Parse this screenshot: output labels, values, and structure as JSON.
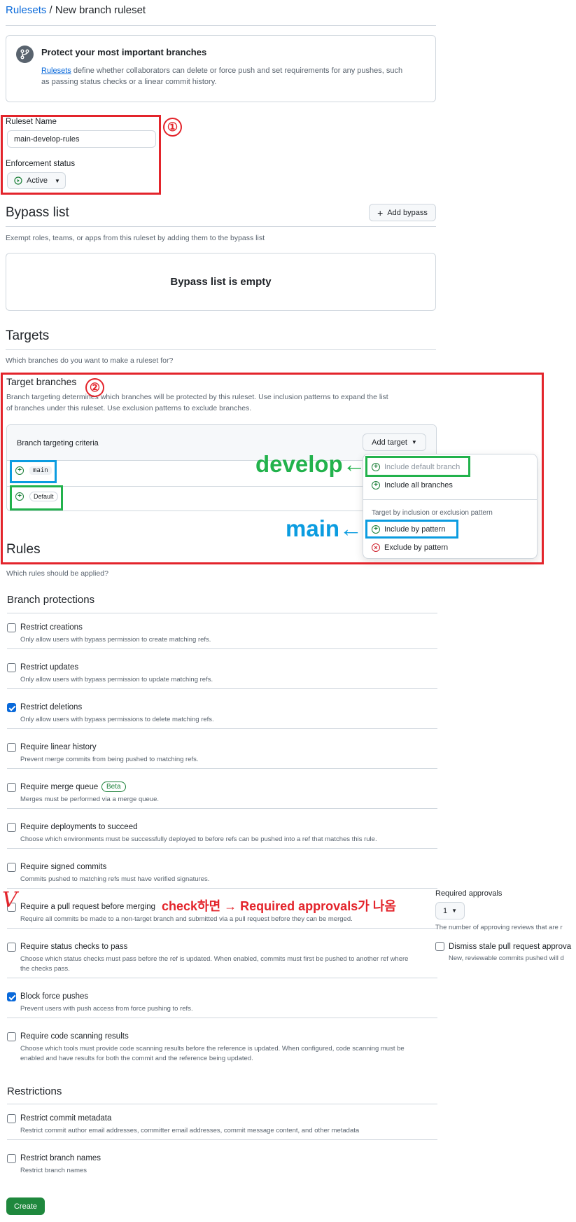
{
  "breadcrumb": {
    "root": "Rulesets",
    "sep": "/",
    "current": "New branch ruleset"
  },
  "banner": {
    "title": "Protect your most important branches",
    "link": "Rulesets",
    "text1": " define whether collaborators can delete or force push and set requirements for any pushes, such",
    "text2": "as passing status checks or a linear commit history."
  },
  "ruleset": {
    "name_label": "Ruleset Name",
    "name_value": "main-develop-rules",
    "enforcement_label": "Enforcement status",
    "enforcement_value": "Active"
  },
  "bypass": {
    "heading": "Bypass list",
    "add_button": "Add bypass",
    "description": "Exempt roles, teams, or apps from this ruleset by adding them to the bypass list",
    "empty": "Bypass list is empty"
  },
  "targets": {
    "heading": "Targets",
    "description": "Which branches do you want to make a ruleset for?",
    "branches_heading": "Target branches",
    "branches_desc1": "Branch targeting determines which branches will be protected by this ruleset. Use inclusion patterns to expand the list",
    "branches_desc2": "of branches under this ruleset. Use exclusion patterns to exclude branches.",
    "criteria_label": "Branch targeting criteria",
    "add_target": "Add target",
    "rows": [
      "main",
      "Default"
    ],
    "menu": {
      "include_default": "Include default branch",
      "include_all": "Include all branches",
      "section": "Target by inclusion or exclusion pattern",
      "include_pattern": "Include by pattern",
      "exclude_pattern": "Exclude by pattern"
    }
  },
  "rules": {
    "heading": "Rules",
    "description": "Which rules should be applied?",
    "protections_heading": "Branch protections",
    "items": [
      {
        "title": "Restrict creations",
        "desc": "Only allow users with bypass permission to create matching refs.",
        "checked": false
      },
      {
        "title": "Restrict updates",
        "desc": "Only allow users with bypass permission to update matching refs.",
        "checked": false
      },
      {
        "title": "Restrict deletions",
        "desc": "Only allow users with bypass permissions to delete matching refs.",
        "checked": true
      },
      {
        "title": "Require linear history",
        "desc": "Prevent merge commits from being pushed to matching refs.",
        "checked": false
      },
      {
        "title": "Require merge queue",
        "badge": "Beta",
        "desc": "Merges must be performed via a merge queue.",
        "checked": false
      },
      {
        "title": "Require deployments to succeed",
        "desc": "Choose which environments must be successfully deployed to before refs can be pushed into a ref that matches this rule.",
        "checked": false
      },
      {
        "title": "Require signed commits",
        "desc": "Commits pushed to matching refs must have verified signatures.",
        "checked": false
      },
      {
        "title": "Require a pull request before merging",
        "desc": "Require all commits be made to a non-target branch and submitted via a pull request before they can be merged.",
        "checked": false
      },
      {
        "title": "Require status checks to pass",
        "desc": "Choose which status checks must pass before the ref is updated. When enabled, commits must first be pushed to another ref where",
        "desc2": "the checks pass.",
        "checked": false
      },
      {
        "title": "Block force pushes",
        "desc": "Prevent users with push access from force pushing to refs.",
        "checked": true
      },
      {
        "title": "Require code scanning results",
        "desc": "Choose which tools must provide code scanning results before the reference is updated. When configured, code scanning must be",
        "desc2": "enabled and have results for both the commit and the reference being updated.",
        "checked": false
      }
    ],
    "restrictions_heading": "Restrictions",
    "restrictions": [
      {
        "title": "Restrict commit metadata",
        "desc": "Restrict commit author email addresses, committer email addresses, commit message content, and other metadata",
        "checked": false
      },
      {
        "title": "Restrict branch names",
        "desc": "Restrict branch names",
        "checked": false
      }
    ],
    "side_panel": {
      "approvals_label": "Required approvals",
      "approvals_value": "1",
      "approvals_desc": "The number of approving reviews that are r",
      "dismiss_title": "Dismiss stale pull request approva",
      "dismiss_desc": "New, reviewable commits pushed will d"
    }
  },
  "create_button": "Create",
  "annotations": {
    "one": "①",
    "two": "②",
    "develop": "develop←",
    "main": "main←",
    "check_note": "check하면 → Required approvals가 나옴",
    "checkmark": "V"
  },
  "colors": {
    "red": "#e3242b",
    "blue": "#0b9ce0",
    "green": "#22b24c",
    "primary": "#1f883d",
    "link": "#0969da"
  }
}
